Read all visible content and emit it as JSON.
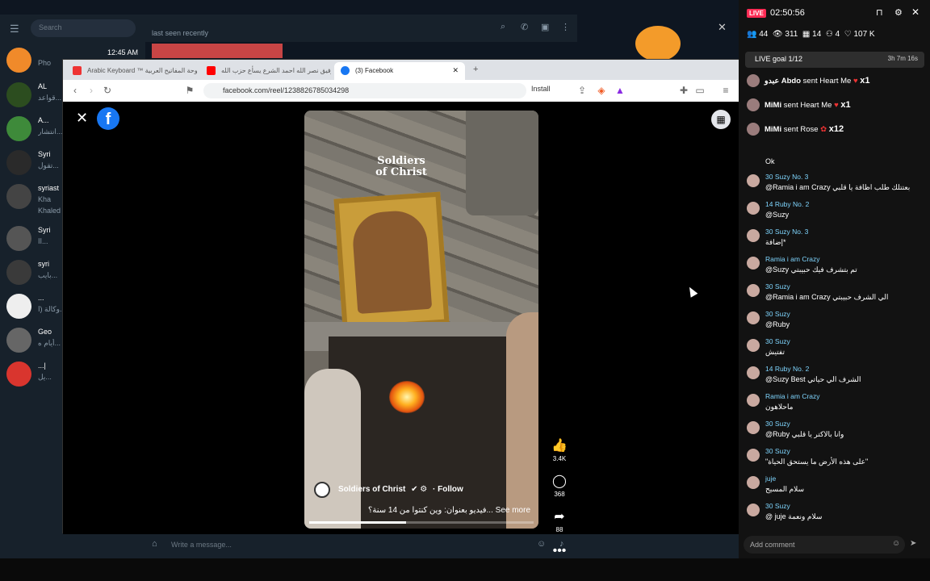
{
  "telegram": {
    "search_placeholder": "Search",
    "chat_status": "last seen recently",
    "time": "12:45 AM",
    "compose_placeholder": "Write a message...",
    "chats": [
      {
        "name": "",
        "sub": "Pho",
        "color": "#f08a2a"
      },
      {
        "name": "AL",
        "sub": "قواعد...",
        "color": "#2c4d1f"
      },
      {
        "name": "A...",
        "sub": "انتشار...",
        "color": "#3e8a3a"
      },
      {
        "name": "Syri",
        "sub": "تقول...",
        "color": "#2a2a2a"
      },
      {
        "name": "syriast",
        "sub": "Kha",
        "color": "#444"
      },
      {
        "name": "Syri",
        "sub": "اا...",
        "color": "#555"
      },
      {
        "name": "syri",
        "sub": "بايب...",
        "color": "#3a3a3a"
      },
      {
        "name": "...",
        "sub": "وكالة (ا...",
        "color": "#eee"
      },
      {
        "name": "Geo",
        "sub": "أيام ه...",
        "color": "#666"
      },
      {
        "name": "...|",
        "sub": "يل...",
        "color": "#d9352e"
      }
    ],
    "extra_line": "Khaled"
  },
  "browser": {
    "tabs": [
      {
        "label": "Arabic Keyboard ™ لوحة المفاتيح العربية",
        "color": "#e33"
      },
      {
        "label": "رفيق نصر الله احمد الشرع يسأع حزب الله",
        "color": "#f00"
      },
      {
        "label": "(3) Facebook",
        "color": "#1877f2"
      }
    ],
    "new_tab": "+",
    "url": "facebook.com/reel/1238826785034298",
    "install_label": "Install"
  },
  "reel": {
    "overlay_title_1": "Soldiers",
    "overlay_title_2": "of Christ",
    "channel_name": "Soldiers of Christ",
    "follow_label": "· Follow",
    "caption": "فيديو بعنوان: وين كنتوا من 14 سنة؟... See more",
    "likes": "3.4K",
    "comments": "368",
    "shares": "88",
    "progress": 0.43
  },
  "live": {
    "badge": "LIVE",
    "time": "02:50:56",
    "viewers_icon_count": "44",
    "views": "311",
    "count_a": "14",
    "count_b": "4",
    "likes": "107 K",
    "goal_label": "LIVE goal 1/12",
    "goal_time": "3h 7m 16s",
    "gifts": [
      {
        "user": "عبدو Abdo",
        "action": "sent Heart Me",
        "qty": "x1"
      },
      {
        "user": "MiMi",
        "action": "sent Heart Me",
        "qty": "x1"
      },
      {
        "user": "MiMi",
        "action": "sent Rose",
        "qty": "x12"
      }
    ],
    "comments": [
      {
        "user": "",
        "msg": "Ok"
      },
      {
        "user": "30 Suzy No. 3",
        "msg": "@Ramia i am Crazy بعتتلك طلب اظافة يا قلبي"
      },
      {
        "user": "14 Ruby No. 2",
        "msg": "@Suzy"
      },
      {
        "user": "30 Suzy No. 3",
        "msg": "إضافة*"
      },
      {
        "user": "Ramia i am Crazy",
        "msg": "@Suzy تم بتشرف فيك حبيبتي"
      },
      {
        "user": "30 Suzy",
        "msg": "@Ramia i am Crazy الي الشرف حبيبتي"
      },
      {
        "user": "30 Suzy",
        "msg": "@Ruby"
      },
      {
        "user": "30 Suzy",
        "msg": "تفتيش"
      },
      {
        "user": "14 Ruby No. 2",
        "msg": "@Suzy Best الشرف الي حياتي"
      },
      {
        "user": "Ramia i am Crazy",
        "msg": "ماحلاهون"
      },
      {
        "user": "30 Suzy",
        "msg": "@Ruby وانا بالاكتر يا قلبي"
      },
      {
        "user": "30 Suzy",
        "msg": "\"على هذه الأرض ما يستحق الحياة\""
      },
      {
        "user": "juje",
        "msg": "سلام المسيح"
      },
      {
        "user": "30 Suzy",
        "msg": "@ juje سلام ونعمة"
      }
    ],
    "add_comment": "Add comment"
  }
}
